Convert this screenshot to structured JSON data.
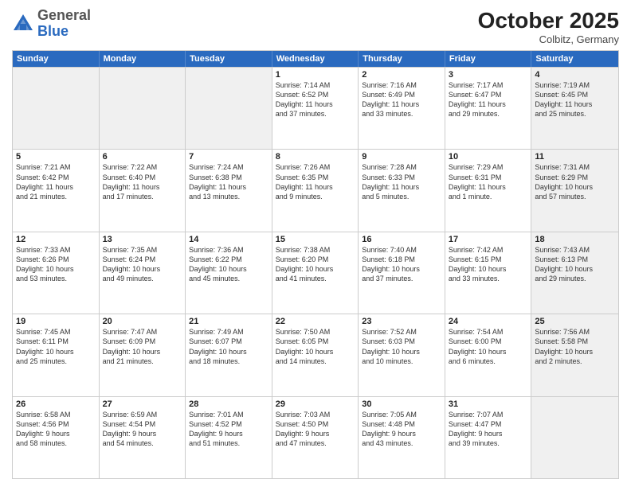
{
  "header": {
    "logo_general": "General",
    "logo_blue": "Blue",
    "month_title": "October 2025",
    "location": "Colbitz, Germany"
  },
  "weekdays": [
    "Sunday",
    "Monday",
    "Tuesday",
    "Wednesday",
    "Thursday",
    "Friday",
    "Saturday"
  ],
  "weeks": [
    [
      {
        "day": "",
        "info": "",
        "shaded": true
      },
      {
        "day": "",
        "info": "",
        "shaded": true
      },
      {
        "day": "",
        "info": "",
        "shaded": true
      },
      {
        "day": "1",
        "info": "Sunrise: 7:14 AM\nSunset: 6:52 PM\nDaylight: 11 hours\nand 37 minutes.",
        "shaded": false
      },
      {
        "day": "2",
        "info": "Sunrise: 7:16 AM\nSunset: 6:49 PM\nDaylight: 11 hours\nand 33 minutes.",
        "shaded": false
      },
      {
        "day": "3",
        "info": "Sunrise: 7:17 AM\nSunset: 6:47 PM\nDaylight: 11 hours\nand 29 minutes.",
        "shaded": false
      },
      {
        "day": "4",
        "info": "Sunrise: 7:19 AM\nSunset: 6:45 PM\nDaylight: 11 hours\nand 25 minutes.",
        "shaded": true
      }
    ],
    [
      {
        "day": "5",
        "info": "Sunrise: 7:21 AM\nSunset: 6:42 PM\nDaylight: 11 hours\nand 21 minutes.",
        "shaded": false
      },
      {
        "day": "6",
        "info": "Sunrise: 7:22 AM\nSunset: 6:40 PM\nDaylight: 11 hours\nand 17 minutes.",
        "shaded": false
      },
      {
        "day": "7",
        "info": "Sunrise: 7:24 AM\nSunset: 6:38 PM\nDaylight: 11 hours\nand 13 minutes.",
        "shaded": false
      },
      {
        "day": "8",
        "info": "Sunrise: 7:26 AM\nSunset: 6:35 PM\nDaylight: 11 hours\nand 9 minutes.",
        "shaded": false
      },
      {
        "day": "9",
        "info": "Sunrise: 7:28 AM\nSunset: 6:33 PM\nDaylight: 11 hours\nand 5 minutes.",
        "shaded": false
      },
      {
        "day": "10",
        "info": "Sunrise: 7:29 AM\nSunset: 6:31 PM\nDaylight: 11 hours\nand 1 minute.",
        "shaded": false
      },
      {
        "day": "11",
        "info": "Sunrise: 7:31 AM\nSunset: 6:29 PM\nDaylight: 10 hours\nand 57 minutes.",
        "shaded": true
      }
    ],
    [
      {
        "day": "12",
        "info": "Sunrise: 7:33 AM\nSunset: 6:26 PM\nDaylight: 10 hours\nand 53 minutes.",
        "shaded": false
      },
      {
        "day": "13",
        "info": "Sunrise: 7:35 AM\nSunset: 6:24 PM\nDaylight: 10 hours\nand 49 minutes.",
        "shaded": false
      },
      {
        "day": "14",
        "info": "Sunrise: 7:36 AM\nSunset: 6:22 PM\nDaylight: 10 hours\nand 45 minutes.",
        "shaded": false
      },
      {
        "day": "15",
        "info": "Sunrise: 7:38 AM\nSunset: 6:20 PM\nDaylight: 10 hours\nand 41 minutes.",
        "shaded": false
      },
      {
        "day": "16",
        "info": "Sunrise: 7:40 AM\nSunset: 6:18 PM\nDaylight: 10 hours\nand 37 minutes.",
        "shaded": false
      },
      {
        "day": "17",
        "info": "Sunrise: 7:42 AM\nSunset: 6:15 PM\nDaylight: 10 hours\nand 33 minutes.",
        "shaded": false
      },
      {
        "day": "18",
        "info": "Sunrise: 7:43 AM\nSunset: 6:13 PM\nDaylight: 10 hours\nand 29 minutes.",
        "shaded": true
      }
    ],
    [
      {
        "day": "19",
        "info": "Sunrise: 7:45 AM\nSunset: 6:11 PM\nDaylight: 10 hours\nand 25 minutes.",
        "shaded": false
      },
      {
        "day": "20",
        "info": "Sunrise: 7:47 AM\nSunset: 6:09 PM\nDaylight: 10 hours\nand 21 minutes.",
        "shaded": false
      },
      {
        "day": "21",
        "info": "Sunrise: 7:49 AM\nSunset: 6:07 PM\nDaylight: 10 hours\nand 18 minutes.",
        "shaded": false
      },
      {
        "day": "22",
        "info": "Sunrise: 7:50 AM\nSunset: 6:05 PM\nDaylight: 10 hours\nand 14 minutes.",
        "shaded": false
      },
      {
        "day": "23",
        "info": "Sunrise: 7:52 AM\nSunset: 6:03 PM\nDaylight: 10 hours\nand 10 minutes.",
        "shaded": false
      },
      {
        "day": "24",
        "info": "Sunrise: 7:54 AM\nSunset: 6:00 PM\nDaylight: 10 hours\nand 6 minutes.",
        "shaded": false
      },
      {
        "day": "25",
        "info": "Sunrise: 7:56 AM\nSunset: 5:58 PM\nDaylight: 10 hours\nand 2 minutes.",
        "shaded": true
      }
    ],
    [
      {
        "day": "26",
        "info": "Sunrise: 6:58 AM\nSunset: 4:56 PM\nDaylight: 9 hours\nand 58 minutes.",
        "shaded": false
      },
      {
        "day": "27",
        "info": "Sunrise: 6:59 AM\nSunset: 4:54 PM\nDaylight: 9 hours\nand 54 minutes.",
        "shaded": false
      },
      {
        "day": "28",
        "info": "Sunrise: 7:01 AM\nSunset: 4:52 PM\nDaylight: 9 hours\nand 51 minutes.",
        "shaded": false
      },
      {
        "day": "29",
        "info": "Sunrise: 7:03 AM\nSunset: 4:50 PM\nDaylight: 9 hours\nand 47 minutes.",
        "shaded": false
      },
      {
        "day": "30",
        "info": "Sunrise: 7:05 AM\nSunset: 4:48 PM\nDaylight: 9 hours\nand 43 minutes.",
        "shaded": false
      },
      {
        "day": "31",
        "info": "Sunrise: 7:07 AM\nSunset: 4:47 PM\nDaylight: 9 hours\nand 39 minutes.",
        "shaded": false
      },
      {
        "day": "",
        "info": "",
        "shaded": true
      }
    ]
  ]
}
